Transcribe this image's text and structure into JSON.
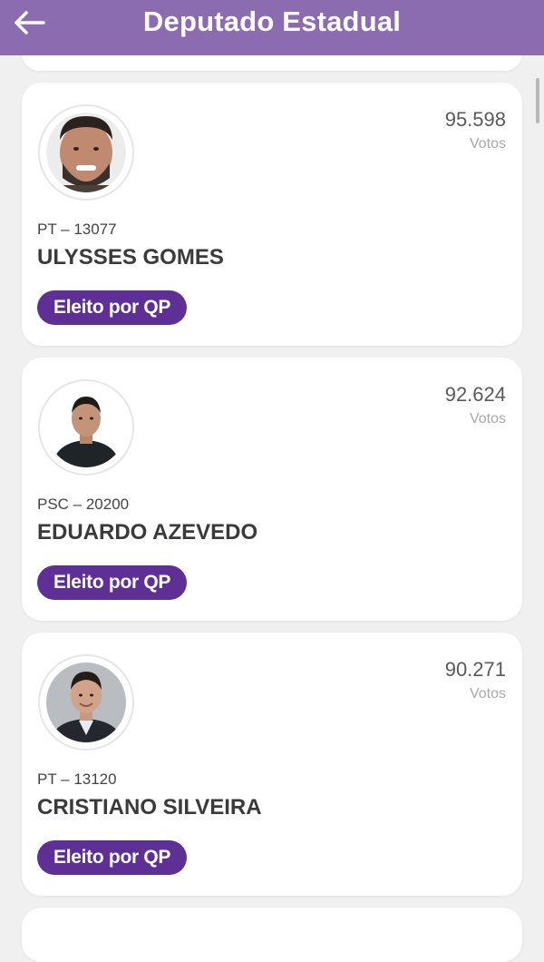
{
  "header": {
    "title": "Deputado Estadual",
    "back_icon": "arrow-left-icon",
    "background_color": "#8b6cb0"
  },
  "candidates": [
    {
      "party_number": "PT – 13077",
      "name": "ULYSSES GOMES",
      "votes": "95.598",
      "votes_label": "Votos",
      "status": "Eleito por QP"
    },
    {
      "party_number": "PSC – 20200",
      "name": "EDUARDO AZEVEDO",
      "votes": "92.624",
      "votes_label": "Votos",
      "status": "Eleito por QP"
    },
    {
      "party_number": "PT – 13120",
      "name": "CRISTIANO SILVEIRA",
      "votes": "90.271",
      "votes_label": "Votos",
      "status": "Eleito por QP"
    }
  ],
  "colors": {
    "badge": "#5e2f94",
    "page_background": "#f0f0f0"
  }
}
